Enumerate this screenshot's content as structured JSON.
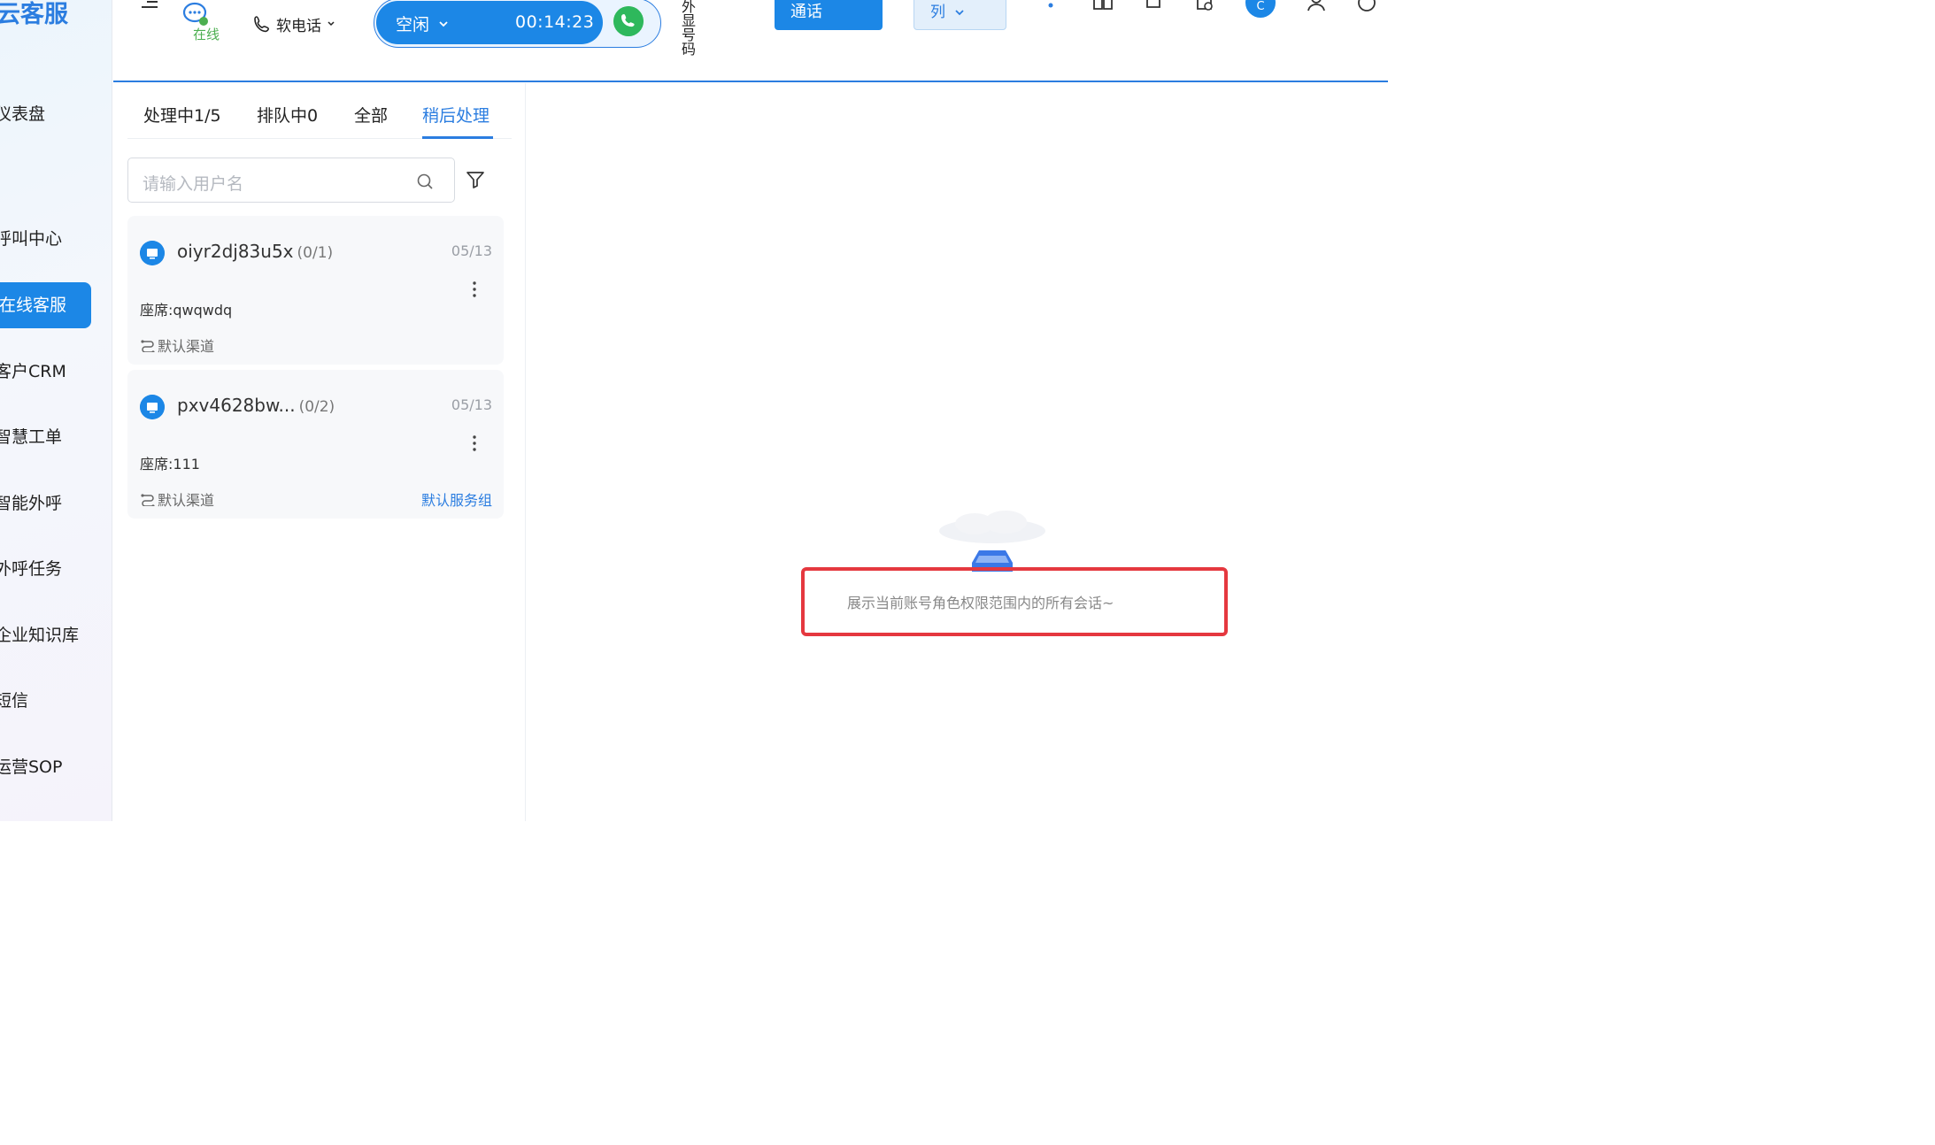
{
  "sidebar": {
    "brand": "云客服",
    "items": [
      {
        "label": "仪表盘"
      },
      {
        "label": "呼叫中心"
      },
      {
        "label": "在线客服"
      },
      {
        "label": "客户CRM"
      },
      {
        "label": "智慧工单"
      },
      {
        "label": "智能外呼"
      },
      {
        "label": "外呼任务"
      },
      {
        "label": "企业知识库"
      },
      {
        "label": "短信"
      },
      {
        "label": "运营SOP"
      }
    ]
  },
  "topbar": {
    "online_status": "在线",
    "softphone_label": "软电话",
    "agent_status": "空闲",
    "call_timer": "00:14:23",
    "outbound_number_label": "外显号码",
    "call_button_label": "通话",
    "queue_select_label": "列",
    "avatar_initial": "C"
  },
  "session_list": {
    "tabs": [
      {
        "label": "处理中1/5"
      },
      {
        "label": "排队中0"
      },
      {
        "label": "全部"
      },
      {
        "label": "稍后处理"
      }
    ],
    "active_tab": "稍后处理",
    "search_placeholder": "请输入用户名",
    "cards": [
      {
        "name": "oiyr2dj83u5x",
        "count": "(0/1)",
        "date": "05/13",
        "seat": "座席:qwqwdq",
        "channel": "默认渠道",
        "group": ""
      },
      {
        "name": "pxv4628bw...",
        "count": "(0/2)",
        "date": "05/13",
        "seat": "座席:111",
        "channel": "默认渠道",
        "group": "默认服务组"
      }
    ]
  },
  "detail": {
    "empty_text": "展示当前账号角色权限范围内的所有会话~"
  },
  "colors": {
    "primary": "#1c87e6",
    "online_green": "#4caf50",
    "call_green": "#2eb85c",
    "highlight_red": "#e5383f"
  }
}
